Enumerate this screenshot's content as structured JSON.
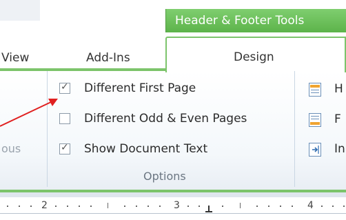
{
  "ribbon": {
    "contextual_header": "Header & Footer Tools",
    "tabs": [
      {
        "label": "View"
      },
      {
        "label": "Add-Ins"
      },
      {
        "label": "Design",
        "active": true
      }
    ],
    "left_group_partial_label": "ous",
    "options_group": {
      "label": "Options",
      "items": [
        {
          "label": "Different First Page",
          "checked": true
        },
        {
          "label": "Different Odd & Even Pages",
          "checked": false
        },
        {
          "label": "Show Document Text",
          "checked": true
        }
      ]
    },
    "navigation_partial": [
      {
        "label": "H",
        "icon": "header-position-icon"
      },
      {
        "label": "F",
        "icon": "footer-position-icon"
      },
      {
        "label": "In",
        "icon": "insert-alignment-tab-icon"
      }
    ]
  },
  "ruler": {
    "numbers": [
      "2",
      "3",
      "4"
    ]
  },
  "annotation": {
    "arrow_color": "#e02020",
    "target": "Different First Page"
  },
  "colors": {
    "contextual_green": "#6cc45a",
    "tab_border_green": "#7cc46b"
  }
}
